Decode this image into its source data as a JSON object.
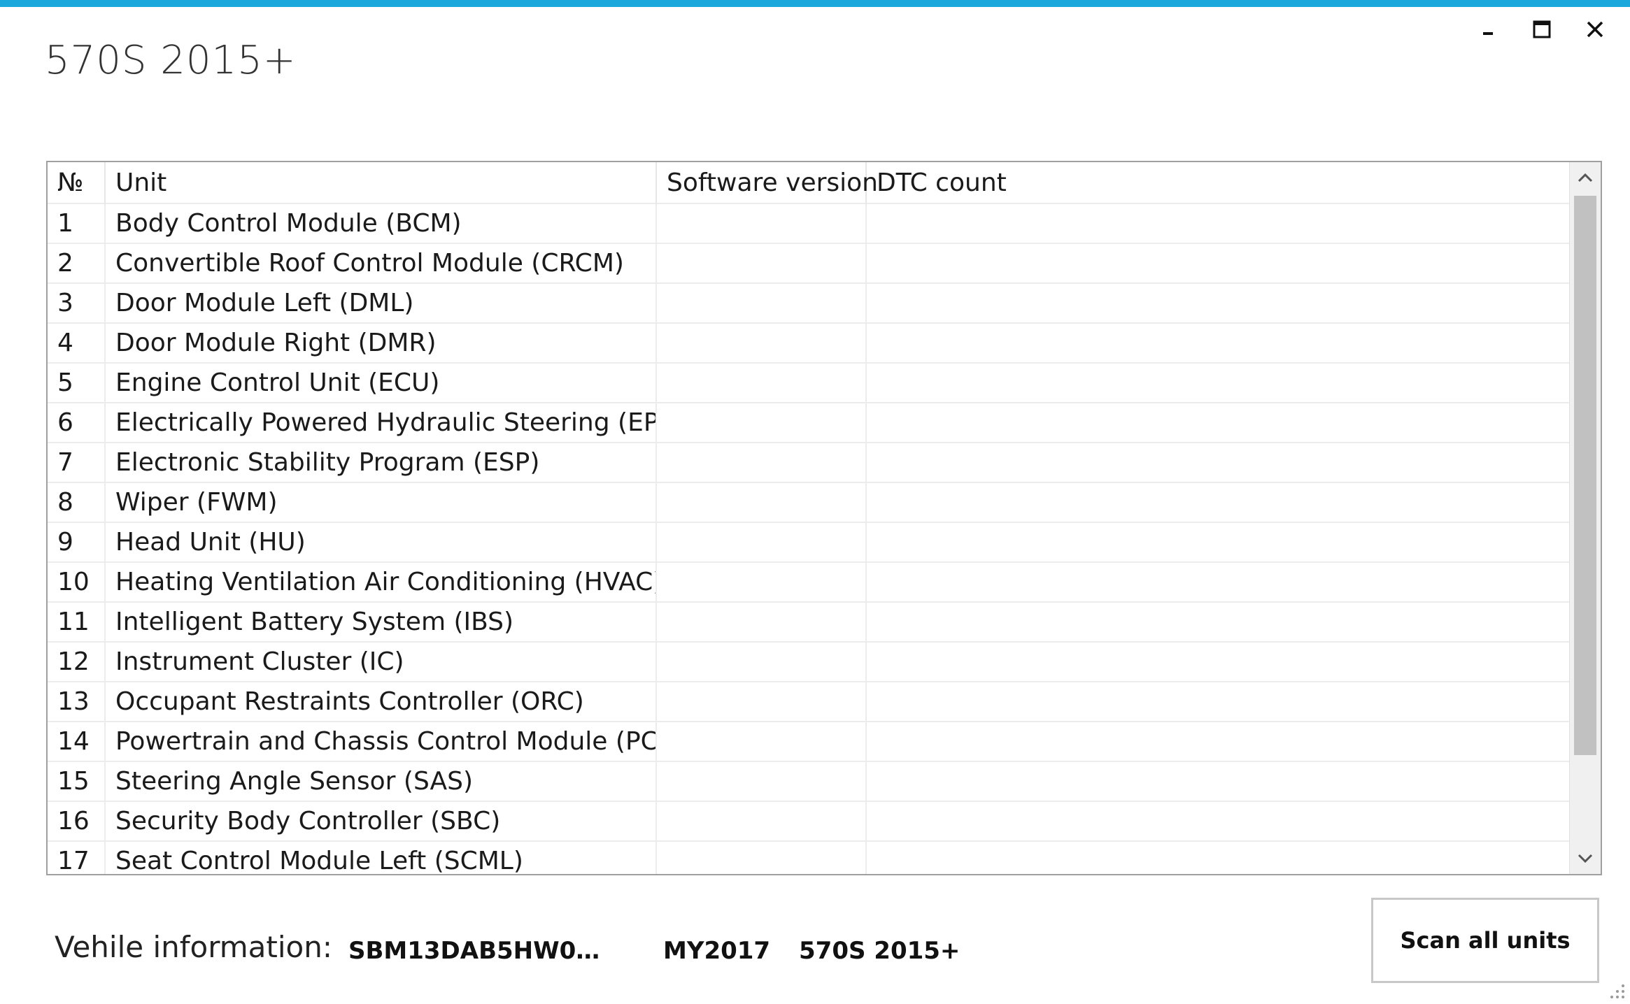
{
  "window": {
    "title": "570S 2015+",
    "accent_color": "#1aa7dc",
    "controls": [
      "minimize-icon",
      "maximize-icon",
      "close-icon"
    ]
  },
  "table": {
    "headers": {
      "no": "№",
      "unit": "Unit",
      "software_version": "Software version",
      "dtc_count": "DTC count"
    },
    "rows": [
      {
        "no": "1",
        "unit": "Body Control Module (BCM)",
        "software_version": "",
        "dtc_count": ""
      },
      {
        "no": "2",
        "unit": "Convertible Roof Control Module (CRCM)",
        "software_version": "",
        "dtc_count": ""
      },
      {
        "no": "3",
        "unit": "Door Module Left (DML)",
        "software_version": "",
        "dtc_count": ""
      },
      {
        "no": "4",
        "unit": "Door Module Right (DMR)",
        "software_version": "",
        "dtc_count": ""
      },
      {
        "no": "5",
        "unit": "Engine Control Unit (ECU)",
        "software_version": "",
        "dtc_count": ""
      },
      {
        "no": "6",
        "unit": "Electrically Powered Hydraulic Steering (EPHS)",
        "software_version": "",
        "dtc_count": ""
      },
      {
        "no": "7",
        "unit": "Electronic Stability Program (ESP)",
        "software_version": "",
        "dtc_count": ""
      },
      {
        "no": "8",
        "unit": "Wiper (FWM)",
        "software_version": "",
        "dtc_count": ""
      },
      {
        "no": "9",
        "unit": "Head Unit (HU)",
        "software_version": "",
        "dtc_count": ""
      },
      {
        "no": "10",
        "unit": "Heating Ventilation Air Conditioning (HVAC)",
        "software_version": "",
        "dtc_count": ""
      },
      {
        "no": "11",
        "unit": "Intelligent Battery System (IBS)",
        "software_version": "",
        "dtc_count": ""
      },
      {
        "no": "12",
        "unit": "Instrument Cluster (IC)",
        "software_version": "",
        "dtc_count": ""
      },
      {
        "no": "13",
        "unit": "Occupant Restraints Controller (ORC)",
        "software_version": "",
        "dtc_count": ""
      },
      {
        "no": "14",
        "unit": "Powertrain and Chassis Control Module (PCCU)",
        "software_version": "",
        "dtc_count": ""
      },
      {
        "no": "15",
        "unit": "Steering Angle Sensor (SAS)",
        "software_version": "",
        "dtc_count": ""
      },
      {
        "no": "16",
        "unit": "Security Body Controller (SBC)",
        "software_version": "",
        "dtc_count": ""
      },
      {
        "no": "17",
        "unit": "Seat Control Module Left (SCML)",
        "software_version": "",
        "dtc_count": ""
      }
    ]
  },
  "vehicle": {
    "label": "Vehile information:",
    "vin": "SBM13DAB5HW0…",
    "model_year": "MY2017",
    "model": "570S 2015+"
  },
  "actions": {
    "scan_all_label": "Scan all units"
  }
}
